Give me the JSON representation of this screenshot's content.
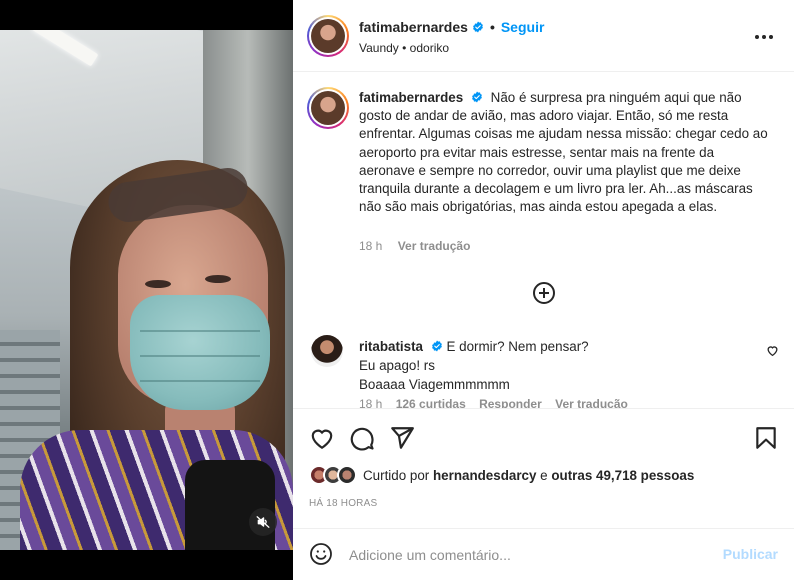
{
  "post": {
    "author": "fatimabernardes",
    "follow_label": "Seguir",
    "audio": "Vaundy • odoriko",
    "caption": "Não é surpresa pra ninguém aqui que não gosto de andar de avião, mas adoro viajar. Então, só me resta enfrentar. Algumas coisas me ajudam nessa missão: chegar cedo ao aeroporto pra evitar mais estresse, sentar mais na frente da aeronave e sempre no corredor, ouvir uma playlist que me deixe tranquila durante a decolagem e um livro pra ler. Ah...as máscaras não são mais obrigatórias, mas ainda estou apegada a elas.",
    "caption_age": "18 h",
    "see_translation": "Ver tradução"
  },
  "comment": {
    "user": "ritabatista",
    "text": "E dormir? Nem pensar?\nEu apago! rs\nBoaaaa Viagemmmmmm",
    "age": "18 h",
    "likes": "126 curtidas",
    "reply": "Responder",
    "see_translation": "Ver tradução"
  },
  "likes": {
    "prefix": "Curtido por",
    "user": "hernandesdarcy",
    "conjunction": "e",
    "others": "outras 49,718 pessoas"
  },
  "timestamp": "HÁ 18 HORAS",
  "add_comment": {
    "placeholder": "Adicione um comentário...",
    "post_label": "Publicar"
  },
  "colors": {
    "accent": "#0095f6",
    "post_disabled": "#b3dbff",
    "muted": "#8e8e8e",
    "text": "#262626"
  }
}
